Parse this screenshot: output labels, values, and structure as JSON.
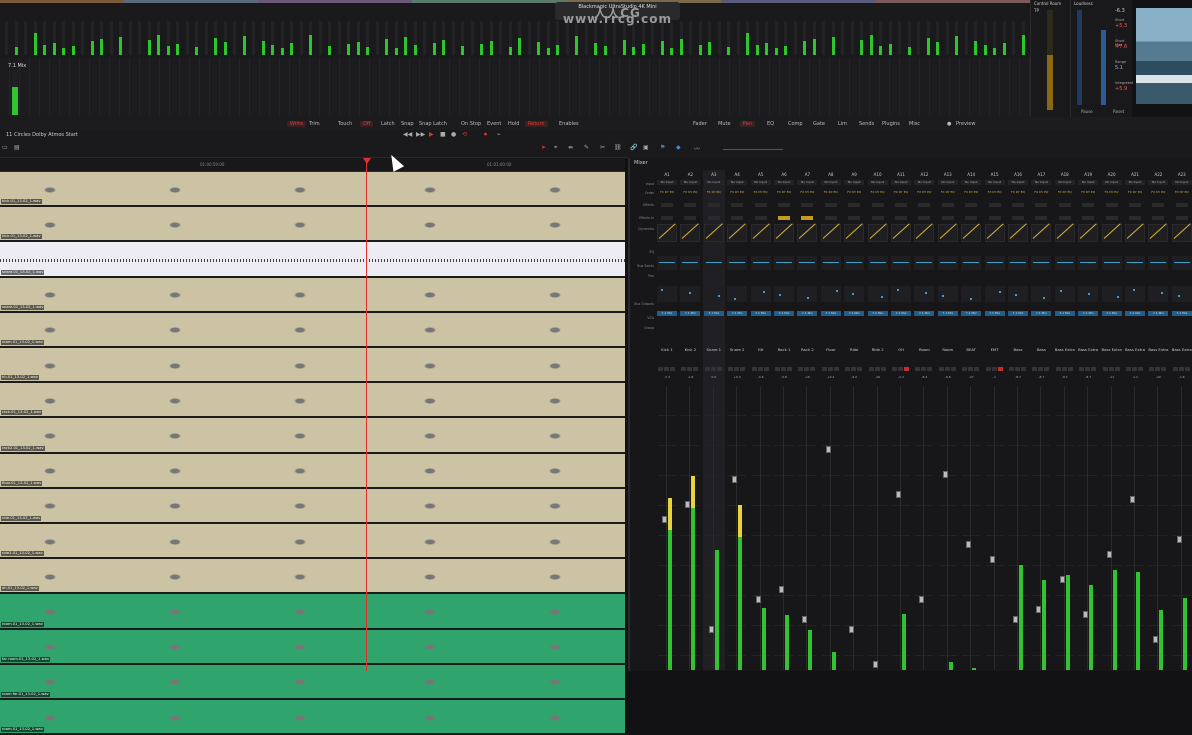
{
  "app": {
    "device_title": "Blackmagic UltraStudio 4K Mini",
    "watermark": "人人CG www.rrcg.com",
    "master_meter_label": "7.1 Mix"
  },
  "panels": {
    "control_room": {
      "title": "Control Room",
      "level": "TP"
    },
    "loudness": {
      "title": "Loudness",
      "value_top": "-6.3",
      "short_label": "Short",
      "short": "+5.3",
      "short_max_label": "Short Max",
      "short_max": "+7.6",
      "range_label": "Range",
      "range": "5.1",
      "integrated_label": "Integrated",
      "integrated": "+5.9",
      "pause": "Pause",
      "reset": "Reset"
    }
  },
  "toolbar": {
    "write": "Write",
    "trim": "Trim",
    "touch": "Touch",
    "off": "Off",
    "latch": "Latch",
    "snap": "Snap",
    "snap_latch": "Snap Latch",
    "on_stop": "On Stop",
    "event": "Event",
    "hold": "Hold",
    "return": "Return",
    "enables": "Enables",
    "fader": "Fader",
    "mute": "Mute",
    "pan": "Pan",
    "eq": "EQ",
    "comp": "Comp",
    "gate": "Gate",
    "lim": "Lim",
    "sends": "Sends",
    "plugins": "Plugins",
    "misc": "Misc",
    "preview": "Preview"
  },
  "timeline": {
    "name": "11 Circles Dolby Atmos Start",
    "timecodes": [
      "01:00:59:00",
      "01:01:00:00"
    ],
    "tracks": [
      {
        "clip": "kick.01_13-02_1.wav",
        "color": "#ccc3a5"
      },
      {
        "clip": "kick.01_13-02_1.wav",
        "color": "#ccc3a5"
      },
      {
        "clip": "snare.01_13-02_1.wav",
        "color": "#ececf2"
      },
      {
        "clip": "snare.01_13-02_1.wav",
        "color": "#ccc3a5"
      },
      {
        "clip": "room.01_13-02_1.wav",
        "color": "#ccc3a5"
      },
      {
        "clip": "hh.01_13-02_1.wav",
        "color": "#ccc3a5"
      },
      {
        "clip": "rack.01_13-02_1.wav",
        "color": "#ccc3a5"
      },
      {
        "clip": "rack2.01_13-02_1.wav",
        "color": "#ccc3a5"
      },
      {
        "clip": "floor.01_13-02_1.wav",
        "color": "#ccc3a5"
      },
      {
        "clip": "ride.01_13-02_1.wav",
        "color": "#ccc3a5"
      },
      {
        "clip": "ride2.01_13-02_1.wav",
        "color": "#ccc3a5"
      },
      {
        "clip": "oh.01_13-02_1.wav",
        "color": "#ccc3a5"
      },
      {
        "clip": "room.01_13-02_1.wav",
        "color": "#2fa56d"
      },
      {
        "clip": "far room.01_13-02_1.wav",
        "color": "#2fa56d"
      },
      {
        "clip": "room far.01_13-02_1.wav",
        "color": "#2fa56d"
      },
      {
        "clip": "room.01_13-02_1.wav",
        "color": "#2fa56d"
      }
    ]
  },
  "mixer": {
    "title": "Mixer",
    "row_labels": [
      "Input",
      "Order",
      "Effects",
      "Effects In",
      "Dynamics",
      "EQ",
      "Bus Sends",
      "Pan",
      "Bus Outputs",
      "VCA",
      "Group"
    ],
    "no_input": "No Input",
    "order": "FX DY EQ",
    "output": "7.1 Mix",
    "channels": [
      {
        "id": "A1",
        "name": "Kick 1",
        "vol": "-7.3"
      },
      {
        "id": "A2",
        "name": "Kick 2",
        "vol": "-1.8"
      },
      {
        "id": "A3",
        "name": "Snare 1",
        "vol": "0.0"
      },
      {
        "id": "A4",
        "name": "Snare 2",
        "vol": "+0.3"
      },
      {
        "id": "A5",
        "name": "HH",
        "vol": "-4.6"
      },
      {
        "id": "A6",
        "name": "Rack 1",
        "vol": "-5.8"
      },
      {
        "id": "A7",
        "name": "Rack 2",
        "vol": "-16"
      },
      {
        "id": "A8",
        "name": "Floor",
        "vol": "+0.2"
      },
      {
        "id": "A9",
        "name": "Ride",
        "vol": "-9.0"
      },
      {
        "id": "A10",
        "name": "Ride 2",
        "vol": "-26"
      },
      {
        "id": "A11",
        "name": "OH",
        "vol": "-2.3"
      },
      {
        "id": "A12",
        "name": "Room",
        "vol": "-8.4"
      },
      {
        "id": "A13",
        "name": "Room",
        "vol": "-6.6"
      },
      {
        "id": "A14",
        "name": "BEAT",
        "vol": "-27"
      },
      {
        "id": "A15",
        "name": "EMT",
        "vol": "-∞"
      },
      {
        "id": "A16",
        "name": "Bass",
        "vol": "-8.7"
      },
      {
        "id": "A17",
        "name": "Bass",
        "vol": "-8.7"
      },
      {
        "id": "A18",
        "name": "Bass Extra",
        "vol": "-8.7"
      },
      {
        "id": "A19",
        "name": "Bass Extra",
        "vol": "-8.7"
      },
      {
        "id": "A20",
        "name": "Bass Extra",
        "vol": "-11"
      },
      {
        "id": "A21",
        "name": "Bass Extra",
        "vol": "-1.2"
      },
      {
        "id": "A22",
        "name": "Bass Extra",
        "vol": "-20"
      },
      {
        "id": "A23",
        "name": "Bass Extra",
        "vol": "-1.6"
      }
    ]
  },
  "colors": {
    "accent_red": "#e03030",
    "meter_green": "#2fc52f",
    "meter_peak": "#e8d43a",
    "clip_beige": "#ccc3a5",
    "clip_green": "#2fa56d"
  }
}
